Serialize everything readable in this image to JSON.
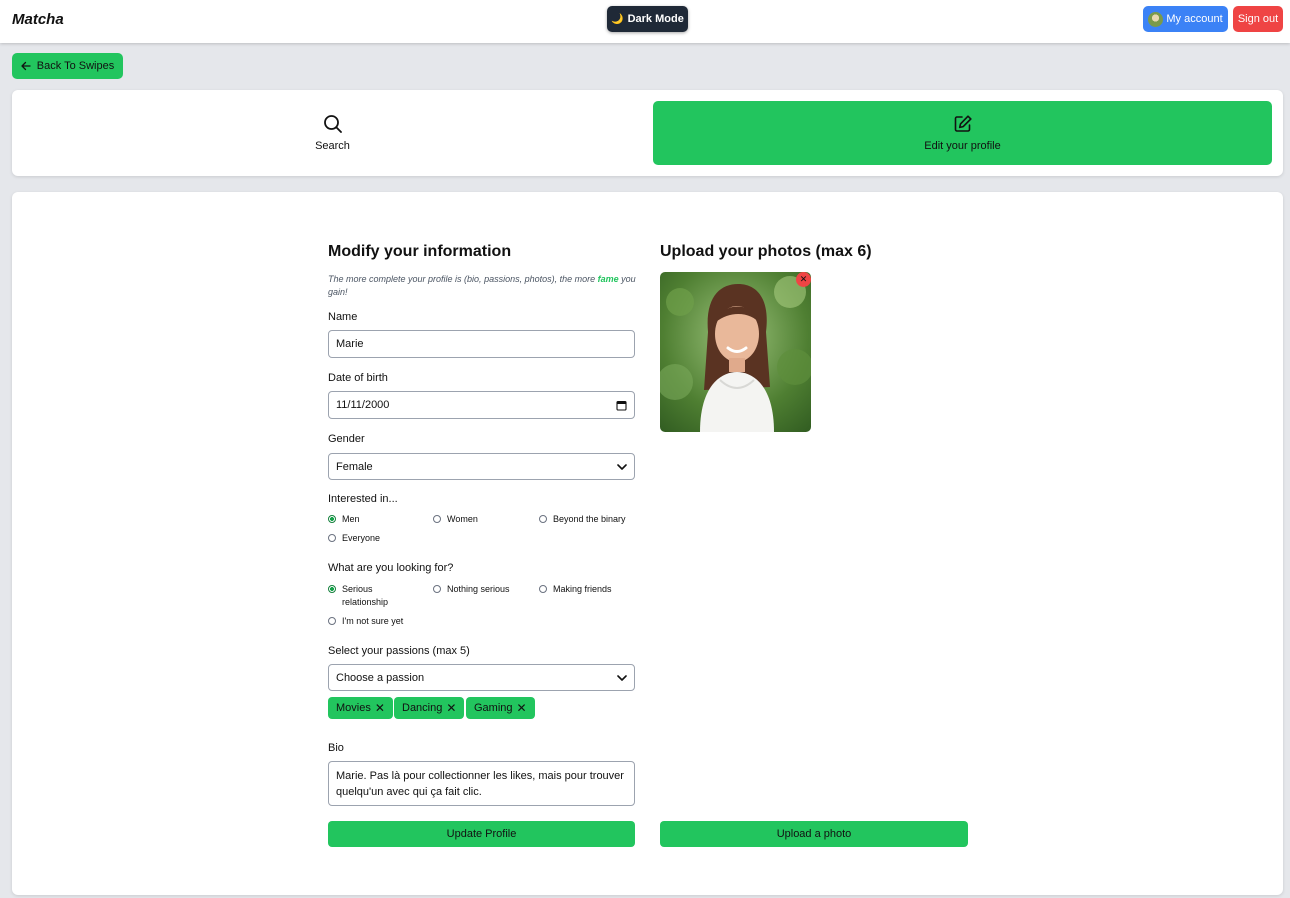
{
  "header": {
    "logo": "Matcha",
    "dark_mode_label": "Dark Mode",
    "account_label": "My account",
    "signout_label": "Sign out"
  },
  "back_label": "Back To Swipes",
  "tabs": [
    {
      "label": "Search",
      "icon": "search-icon",
      "active": false
    },
    {
      "label": "Edit your profile",
      "icon": "edit-icon",
      "active": true
    }
  ],
  "form": {
    "title": "Modify your information",
    "hint_pre": "The more complete your profile is (bio, passions, photos), the more ",
    "hint_em": "fame",
    "hint_post": " you gain!",
    "name_label": "Name",
    "name_value": "Marie",
    "dob_label": "Date of birth",
    "dob_value": "11/11/2000",
    "gender_label": "Gender",
    "gender_value": "Female",
    "interest_label": "Interested in...",
    "interest_options": [
      {
        "label": "Men",
        "checked": true
      },
      {
        "label": "Women",
        "checked": false
      },
      {
        "label": "Beyond the binary",
        "checked": false
      },
      {
        "label": "Everyone",
        "checked": false
      }
    ],
    "looking_label": "What are you looking for?",
    "looking_options": [
      {
        "label": "Serious relationship",
        "checked": true
      },
      {
        "label": "Nothing serious",
        "checked": false
      },
      {
        "label": "Making friends",
        "checked": false
      },
      {
        "label": "I'm not sure yet",
        "checked": false
      }
    ],
    "passions_label": "Select your passions (max 5)",
    "passions_placeholder": "Choose a passion",
    "passions": [
      "Movies",
      "Dancing",
      "Gaming"
    ],
    "bio_label": "Bio",
    "bio_value": "Marie. Pas là pour collectionner les likes, mais pour trouver quelqu'un avec qui ça fait clic.",
    "update_label": "Update Profile"
  },
  "photos": {
    "title": "Upload your photos (max 6)",
    "upload_label": "Upload a photo"
  },
  "colors": {
    "accent": "#22c55e",
    "danger": "#ef4444",
    "primary": "#3b82f6",
    "dark": "#1f2937"
  }
}
